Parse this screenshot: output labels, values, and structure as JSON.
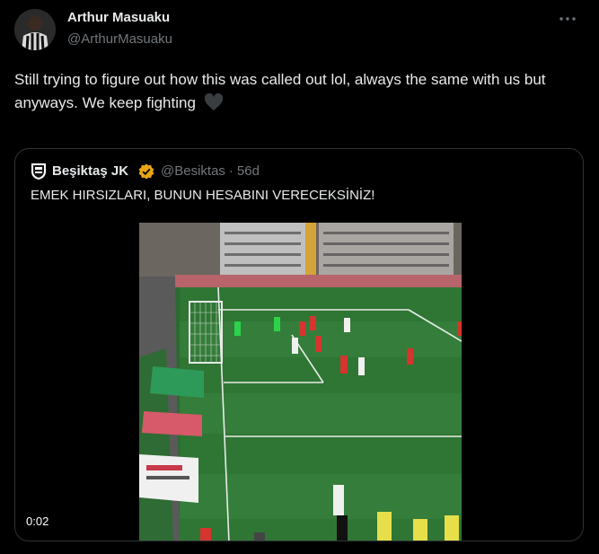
{
  "author": {
    "name": "Arthur Masuaku",
    "handle": "@ArthurMasuaku",
    "avatar_icon": "avatar-photo"
  },
  "tweet": {
    "text": "Still trying to figure out how this was called out lol, always the same with us but anyways. We keep fighting",
    "emoji_icon": "black-heart-icon"
  },
  "quoted": {
    "name": "Beşiktaş JK",
    "handle": "@Besiktas",
    "separator": "·",
    "time": "56d",
    "text": "EMEK HIRSIZLARI, BUNUN HESABINI VERECEKSİNİZ!",
    "verified_color": "#e8a317",
    "video": {
      "duration": "0:02"
    }
  },
  "colors": {
    "background": "#000000",
    "text_primary": "#e7e9ea",
    "text_secondary": "#71767b",
    "border": "#2f3336",
    "pitch": "#2b6a30"
  }
}
